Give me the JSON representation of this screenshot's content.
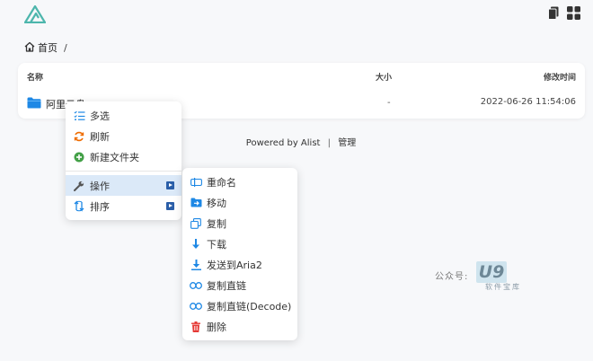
{
  "breadcrumb": {
    "home": "首页",
    "separator": "/"
  },
  "table": {
    "headers": {
      "name": "名称",
      "size": "大小",
      "modified": "修改时间"
    },
    "rows": [
      {
        "name": "阿里云盘",
        "size": "-",
        "modified": "2022-06-26 11:54:06"
      }
    ]
  },
  "footer": {
    "powered": "Powered by Alist",
    "separator": "|",
    "manage": "管理"
  },
  "context_menu": {
    "items": [
      {
        "label": "多选"
      },
      {
        "label": "刷新"
      },
      {
        "label": "新建文件夹"
      },
      {
        "label": "操作"
      },
      {
        "label": "排序"
      }
    ]
  },
  "submenu": {
    "items": [
      {
        "label": "重命名"
      },
      {
        "label": "移动"
      },
      {
        "label": "复制"
      },
      {
        "label": "下载"
      },
      {
        "label": "发送到Aria2"
      },
      {
        "label": "复制直链"
      },
      {
        "label": "复制直链(Decode)"
      },
      {
        "label": "删除"
      }
    ]
  },
  "watermark": {
    "label": "公众号:",
    "logo": "U9",
    "sub": "软件宝库"
  },
  "colors": {
    "accent": "#1e88e5",
    "active_bg": "#dbe9f8",
    "arrow": "#2a5ea8",
    "delete": "#e53935"
  }
}
